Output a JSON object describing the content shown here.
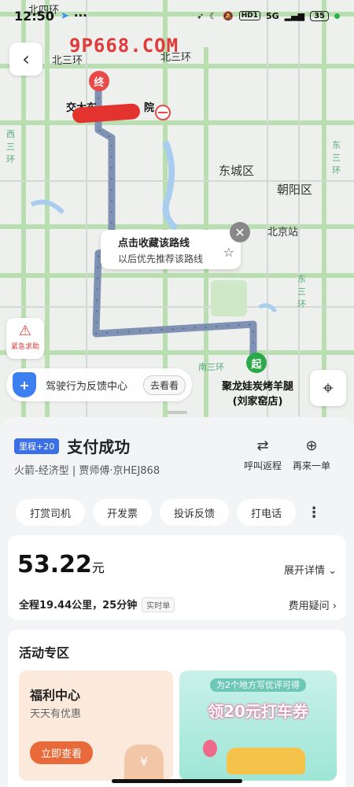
{
  "status_bar": {
    "time": "12:50",
    "hd_badge": "HD1",
    "network": "5G",
    "battery": "35"
  },
  "watermark": "9P668.COM",
  "map": {
    "labels": [
      "北四环",
      "北三环",
      "北三环",
      "东城区",
      "朝阳区",
      "北京站",
      "南三环",
      "西三环",
      "东三环",
      "东三环"
    ],
    "end_marker": "终",
    "end_name": "交大东",
    "end_suffix": "院",
    "start_marker": "起",
    "start_name_line1": "聚龙娃炭烤羊腿",
    "start_name_line2": "(刘家窑店)",
    "fav_popup": {
      "line1": "点击收藏该路线",
      "line2": "以后优先推荐该路线"
    },
    "sos_label": "紧急求助",
    "feedback": {
      "text": "驾驶行为反馈中心",
      "button": "去看看"
    }
  },
  "order": {
    "mileage_badge": "里程+20",
    "title": "支付成功",
    "car_info": "火箭-经济型 | 贾师傅·京HEJ868",
    "return_trip": "呼叫返程",
    "reorder": "再来一单",
    "chips": [
      "打赏司机",
      "开发票",
      "投诉反馈",
      "打电话"
    ]
  },
  "fare": {
    "amount": "53.22",
    "unit": "元",
    "detail_link": "展开详情",
    "distance_time": "全程19.44公里，25分钟",
    "realtime_tag": "实时单",
    "fee_question": "费用疑问"
  },
  "activity": {
    "title": "活动专区",
    "welfare": {
      "title": "福利中心",
      "subtitle": "天天有优惠",
      "button": "立即查看"
    },
    "coupon": {
      "subtitle": "为2个地方写优评可得",
      "title": "领20元打车券"
    }
  },
  "colors": {
    "accent": "#3a6fe8",
    "route": "#7f92b3",
    "end": "#e84a4a",
    "start": "#2ba84a",
    "cta": "#e86a3a"
  }
}
